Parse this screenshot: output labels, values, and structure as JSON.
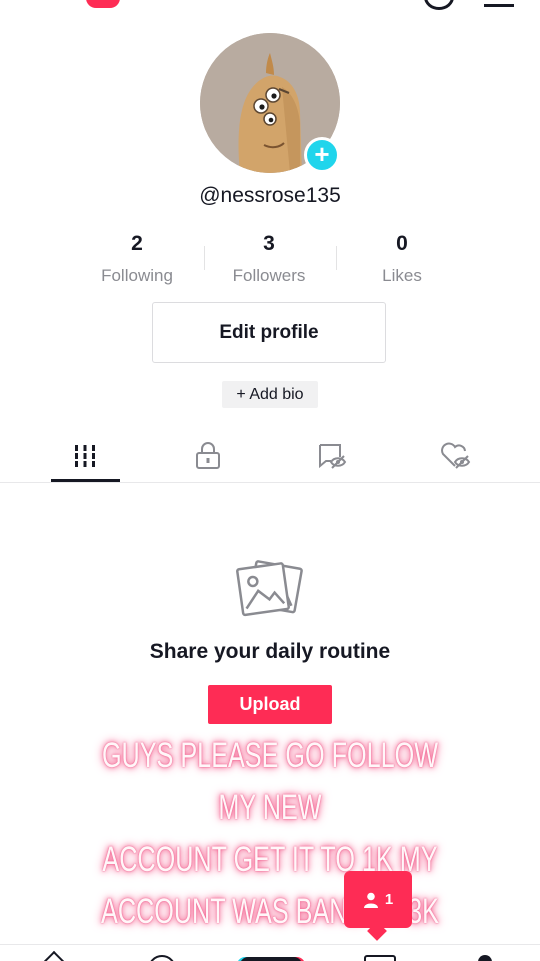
{
  "profile": {
    "username": "@nessrose135",
    "avatar_add_glyph": "+"
  },
  "stats": {
    "following": {
      "value": "2",
      "label": "Following"
    },
    "followers": {
      "value": "3",
      "label": "Followers"
    },
    "likes": {
      "value": "0",
      "label": "Likes"
    }
  },
  "actions": {
    "edit_profile": "Edit profile",
    "add_bio": "+ Add bio"
  },
  "tabs": [
    {
      "icon": "grid-icon",
      "active": true
    },
    {
      "icon": "lock-icon",
      "active": false
    },
    {
      "icon": "tagged-icon",
      "active": false
    },
    {
      "icon": "liked-icon",
      "active": false
    }
  ],
  "empty_state": {
    "icon": "image-icon",
    "title": "Share your daily routine",
    "button": "Upload"
  },
  "overlay_text": {
    "line1": "GUYS PLEASE GO FOLLOW MY NEW",
    "line2": "ACCOUNT GET IT TO 1K MY",
    "line3": "ACCOUNT WAS BAND AT 3K"
  },
  "notification": {
    "icon": "person-icon",
    "count": "1"
  },
  "colors": {
    "accent": "#fe2c55",
    "avatar_badge": "#20d5ec"
  }
}
